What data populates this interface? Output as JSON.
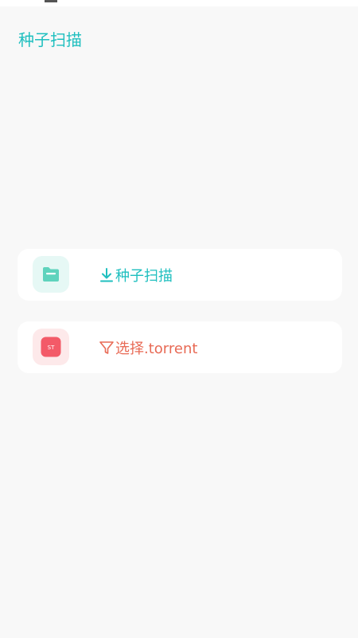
{
  "app": {
    "title": "种子扫描",
    "accent_color": "#1fbfbf"
  },
  "actions": [
    {
      "label": "种子扫描",
      "icon": "download-icon",
      "tile_icon": "folder-icon",
      "text_color": "#1fbfbf",
      "tile_color": "#e6f8f5",
      "tile_icon_color": "#5fd3bd"
    },
    {
      "label": "选择.torrent",
      "icon": "filter-icon",
      "tile_icon": "torrent-file-icon",
      "tile_icon_text": "ST",
      "text_color": "#e86a55",
      "tile_color": "#fde9ea",
      "tile_icon_color": "#f35a68"
    }
  ]
}
